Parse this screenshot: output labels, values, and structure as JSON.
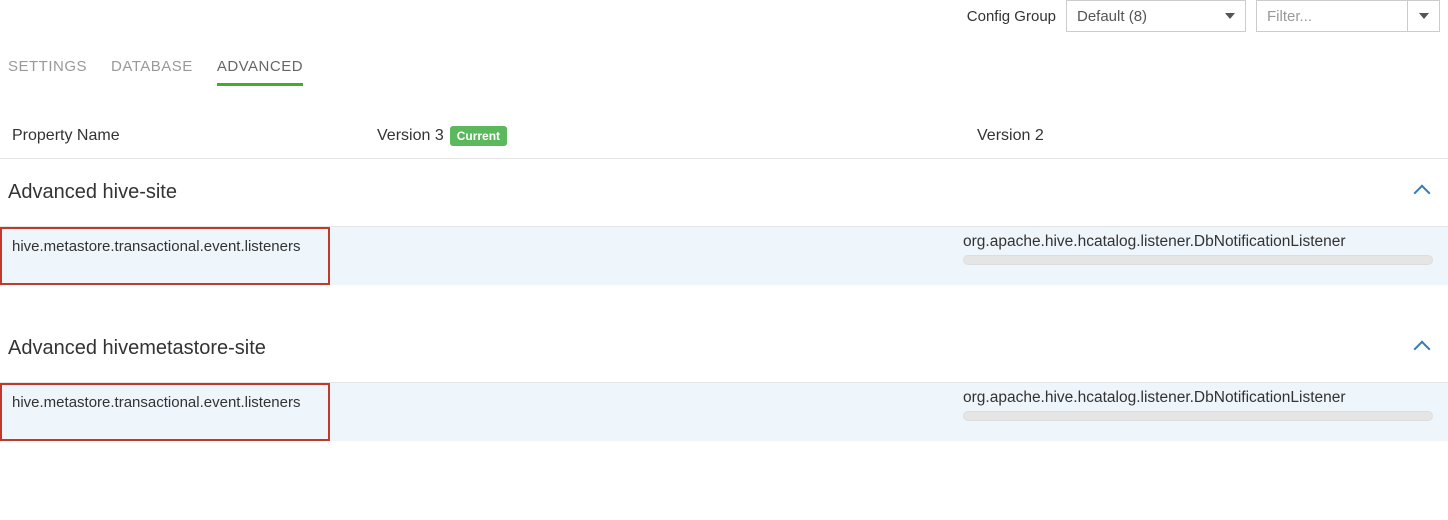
{
  "top": {
    "config_group_label": "Config Group",
    "config_group_selected": "Default (8)",
    "filter_placeholder": "Filter..."
  },
  "tabs": {
    "settings": "SETTINGS",
    "database": "DATABASE",
    "advanced": "ADVANCED"
  },
  "headers": {
    "property_name": "Property Name",
    "version3": "Version 3",
    "current_badge": "Current",
    "version2": "Version 2"
  },
  "sections": [
    {
      "title": "Advanced hive-site",
      "prop_name": "hive.metastore.transactional.event.listeners",
      "v2_value": "org.apache.hive.hcatalog.listener.DbNotificationListener"
    },
    {
      "title": "Advanced hivemetastore-site",
      "prop_name": "hive.metastore.transactional.event.listeners",
      "v2_value": "org.apache.hive.hcatalog.listener.DbNotificationListener"
    }
  ]
}
